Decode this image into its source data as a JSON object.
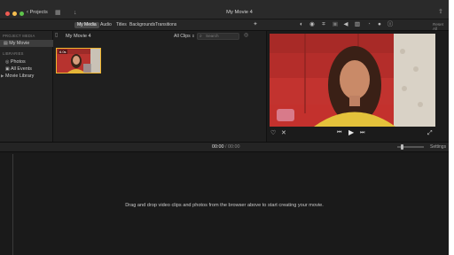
{
  "window": {
    "title": "My Movie 4",
    "back_label": "Projects"
  },
  "toolbar": {
    "tabs": [
      {
        "label": "My Media",
        "active": true
      },
      {
        "label": "Audio",
        "active": false
      },
      {
        "label": "Titles",
        "active": false
      },
      {
        "label": "Backgrounds",
        "active": false
      },
      {
        "label": "Transitions",
        "active": false
      }
    ],
    "reset_label": "Reset All",
    "adjust_icons": [
      "color-balance-icon",
      "color-correction-icon",
      "crop-icon",
      "stabilization-icon",
      "volume-icon",
      "noise-reduction-icon",
      "equalizer-icon",
      "speed-icon",
      "clip-filter-icon",
      "info-icon"
    ]
  },
  "sidebar": {
    "project_media_heading": "PROJECT MEDIA",
    "project_item": "My Movie",
    "libraries_heading": "LIBRARIES",
    "library_items": [
      "Photos",
      "All Events",
      "Movie Library"
    ]
  },
  "browser": {
    "title": "My Movie 4",
    "filter_label": "All Clips",
    "search_placeholder": "Search",
    "clip_duration": "6.0s"
  },
  "timeline": {
    "current_time": "00:00",
    "separator": "/",
    "total_time": "00:00",
    "settings_label": "Settings",
    "empty_message": "Drag and drop video clips and photos from the browser above to start creating your movie."
  },
  "colors": {
    "accent_selection": "#f0b52e",
    "close": "#ee5a52",
    "minimize": "#f5be4f",
    "zoom": "#5ec44b"
  }
}
